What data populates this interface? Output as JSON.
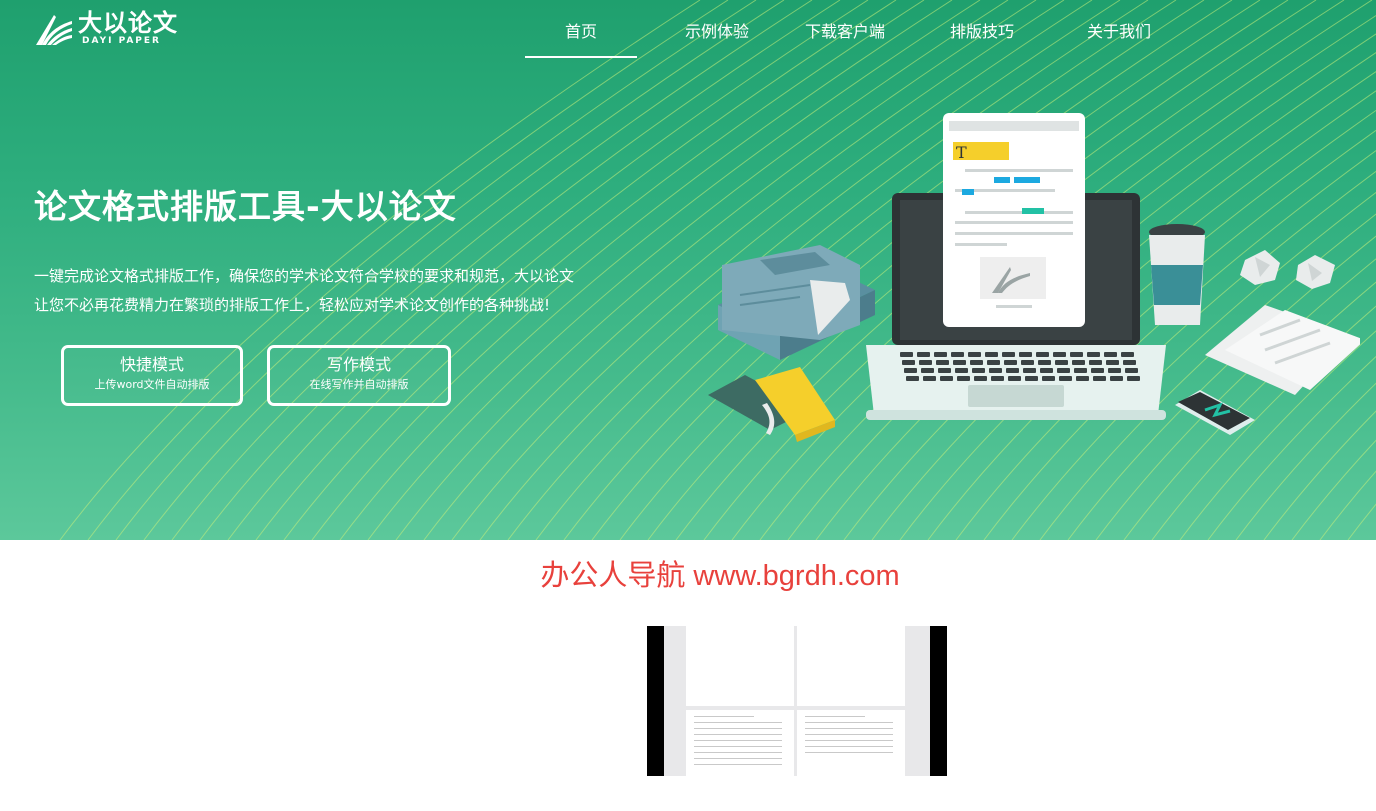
{
  "brand": {
    "name": "大以论文",
    "sub": "DAYI PAPER"
  },
  "nav": {
    "items": [
      {
        "label": "首页",
        "active": true
      },
      {
        "label": "示例体验",
        "active": false
      },
      {
        "label": "下载客户端",
        "active": false
      },
      {
        "label": "排版技巧",
        "active": false
      },
      {
        "label": "关于我们",
        "active": false
      }
    ]
  },
  "hero": {
    "title": "论文格式排版工具-大以论文",
    "desc_line1": "一键完成论文格式排版工作，确保您的学术论文符合学校的要求和规范，大以论文",
    "desc_line2": "让您不必再花费精力在繁琐的排版工作上，轻松应对学术论文创作的各种挑战!",
    "quick_mode": {
      "title": "快捷模式",
      "subtitle": "上传word文件自动排版"
    },
    "write_mode": {
      "title": "写作模式",
      "subtitle": "在线写作并自动排版"
    }
  },
  "watermark": "办公人导航 www.bgrdh.com",
  "colors": {
    "hero_top": "#1fa06e",
    "hero_bottom": "#5cc89b",
    "watermark": "#e8413c",
    "highlight_yellow": "#f5cf2b"
  },
  "illustration_badge": "T"
}
